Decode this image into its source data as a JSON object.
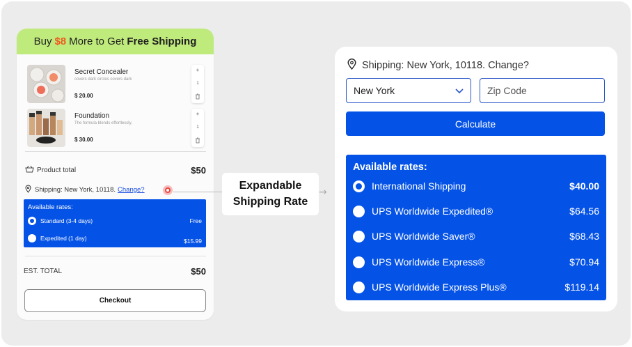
{
  "banner": {
    "prefix": "Buy",
    "amount": "$8",
    "middle": "More to Get",
    "emphasis": "Free Shipping"
  },
  "cart": {
    "items": [
      {
        "name": "Secret Concealer",
        "desc": "covers dark circles covers dark",
        "price": "$ 20.00",
        "qty": "1",
        "thumb_icon": "concealer-image"
      },
      {
        "name": "Foundation",
        "desc": "The formula blends effortlessly,",
        "price": "$ 30.00",
        "qty": "1",
        "thumb_icon": "foundation-image"
      }
    ],
    "product_total_label": "Product total",
    "product_total_value": "$50",
    "shipping_label": "Shipping: New York, 10118.",
    "change_link": "Change?",
    "rates_title": "Available rates:",
    "rates": [
      {
        "label": "Standard (3-4 days)",
        "price": "Free",
        "selected": true
      },
      {
        "label": "Expedited (1 day)",
        "price": "$15.99",
        "selected": false
      }
    ],
    "est_total_label": "EST. TOTAL",
    "est_total_value": "$50",
    "checkout_label": "Checkout"
  },
  "callout": {
    "line1": "Expandable",
    "line2": "Shipping Rate"
  },
  "panel": {
    "shipping_text": "Shipping: New York, 10118. Change?",
    "state_value": "New York",
    "zip_placeholder": "Zip Code",
    "calculate_label": "Calculate",
    "rates_title": "Available rates:",
    "rates": [
      {
        "label": "International Shipping",
        "price": "$40.00",
        "selected": true
      },
      {
        "label": "UPS Worldwide Expedited®",
        "price": "$64.56",
        "selected": false
      },
      {
        "label": "UPS Worldwide Saver®",
        "price": "$68.43",
        "selected": false
      },
      {
        "label": "UPS Worldwide Express®",
        "price": "$70.94",
        "selected": false
      },
      {
        "label": "UPS Worldwide Express Plus®",
        "price": "$119.14",
        "selected": false
      }
    ]
  },
  "colors": {
    "accent_blue": "#0553e6",
    "banner_green": "#bfea7c",
    "banner_amount": "#ee5b1f",
    "link_blue": "#1a4ee0"
  }
}
